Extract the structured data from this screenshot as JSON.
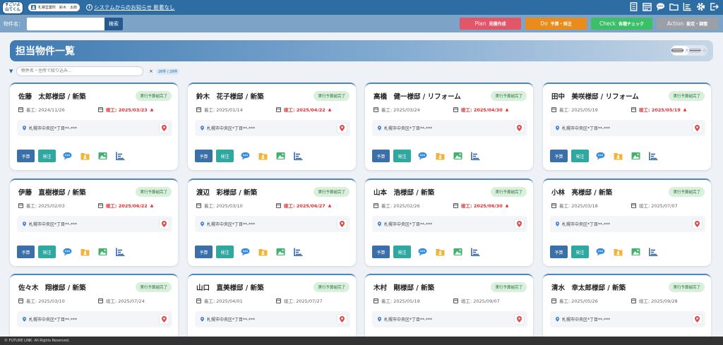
{
  "app": {
    "logo_line1": "すごいよ",
    "logo_line2": "山てくん"
  },
  "header": {
    "user_label": "札幌営業所　鈴木　太郎",
    "notice_text": "システムからのお知らせ 新着なし"
  },
  "search": {
    "label": "物件名：",
    "placeholder": "",
    "button": "検索"
  },
  "pdca": [
    {
      "en": "Plan",
      "ja": "見積作成",
      "color": "#e2566a"
    },
    {
      "en": "Do",
      "ja": "予算・発注",
      "color": "#ea8c1c"
    },
    {
      "en": "Check",
      "ja": "各種チェック",
      "color": "#3dbf69"
    },
    {
      "en": "Action",
      "ja": "設定・調整",
      "color": "#9aa0a6"
    }
  ],
  "page": {
    "title": "担当物件一覧",
    "toggle_large": "大",
    "toggle_small": "小"
  },
  "filter": {
    "placeholder": "物件名・住所で絞り込み...",
    "clear": "×",
    "count": "28件 / 28件"
  },
  "card_labels": {
    "start_prefix": "着工:",
    "end_prefix": "竣工:",
    "budget_btn": "予算",
    "order_btn": "発注",
    "badge": "実行予算組完了"
  },
  "colors": {
    "primary": "#2e6ca4",
    "late": "#dd3333",
    "badge_bg": "#d8f0dc"
  },
  "cards": [
    {
      "name": "佐藤　太郎様邸 / 新築",
      "start": "着工: 2024/11/26",
      "end": "竣工: 2025/03/23",
      "late": true,
      "address": "札幌市中央区*丁目**-***"
    },
    {
      "name": "鈴木　花子様邸 / 新築",
      "start": "着工: 2025/01/14",
      "end": "竣工: 2025/04/22",
      "late": true,
      "address": "札幌市中央区*丁目**-***"
    },
    {
      "name": "高橋　健一様邸 / リフォーム",
      "start": "着工: 2025/03/24",
      "end": "竣工: 2025/04/30",
      "late": true,
      "address": "札幌市中央区*丁目**-***"
    },
    {
      "name": "田中　美咲様邸 / リフォーム",
      "start": "着工: 2025/05/19",
      "end": "竣工: 2025/05/19",
      "late": true,
      "address": "札幌市中央区*丁目**-***"
    },
    {
      "name": "伊藤　直樹様邸 / 新築",
      "start": "着工: 2025/02/03",
      "end": "竣工: 2025/06/22",
      "late": true,
      "address": "札幌市中央区*丁目**-***"
    },
    {
      "name": "渡辺　彩様邸 / 新築",
      "start": "着工: 2025/03/10",
      "end": "竣工: 2025/06/27",
      "late": true,
      "address": "札幌市中央区*丁目**-***"
    },
    {
      "name": "山本　浩様邸 / 新築",
      "start": "着工: 2025/02/26",
      "end": "竣工: 2025/06/30",
      "late": true,
      "address": "札幌市中央区*丁目**-***"
    },
    {
      "name": "小林　亮様邸 / 新築",
      "start": "着工: 2025/03/18",
      "end": "竣工: 2025/07/07",
      "late": false,
      "address": "札幌市中央区*丁目**-***"
    },
    {
      "name": "佐々木　翔様邸 / 新築",
      "start": "着工: 2025/03/10",
      "end": "竣工: 2025/07/24",
      "late": false,
      "address": "札幌市中央区*丁目**-***"
    },
    {
      "name": "山口　直美様邸 / 新築",
      "start": "着工: 2025/04/01",
      "end": "竣工: 2025/07/27",
      "late": false,
      "address": "札幌市中央区*丁目**-***"
    },
    {
      "name": "木村　剛様邸 / 新築",
      "start": "着工: 2025/05/19",
      "end": "竣工: 2025/09/07",
      "late": false,
      "address": "札幌市中央区*丁目**-***"
    },
    {
      "name": "清水　幸太郎様邸 / 新築",
      "start": "着工: 2025/05/26",
      "end": "竣工: 2025/09/28",
      "late": false,
      "address": "札幌市中央区*丁目**-***"
    }
  ],
  "footer": {
    "copyright": "© FUTURE LINK. All Rights Reserved."
  }
}
